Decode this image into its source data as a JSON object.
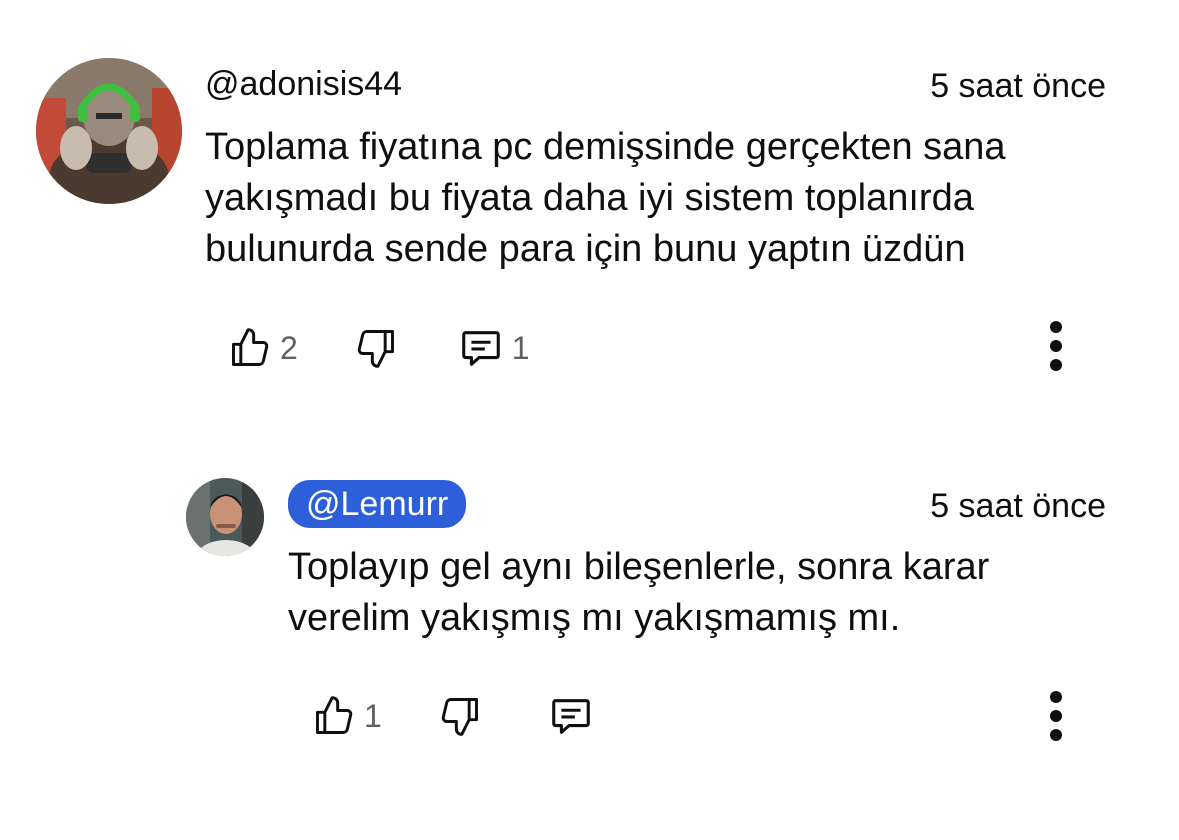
{
  "comments": [
    {
      "author": "@adonisis44",
      "time": "5 saat önce",
      "text": "Toplama fiyatına pc demişsinde gerçekten sana yakışmadı bu fiyata daha iyi sistem toplanırda bulunurda sende para için bunu yaptın üzdün",
      "likes": "2",
      "replies": "1",
      "avatar_icon": "gamer-robot-avatar"
    },
    {
      "author": "@Lemurr",
      "time": "5 saat önce",
      "text": "Toplayıp gel aynı bileşenlerle, sonra karar verelim yakışmış mı yakışmamış mı.",
      "likes": "1",
      "avatar_icon": "man-portrait-avatar"
    }
  ],
  "colors": {
    "badge_blue": "#2c5fd9",
    "text": "#0f0f0f",
    "muted": "#606060"
  },
  "icons": [
    "thumb-up-icon",
    "thumb-down-icon",
    "reply-icon",
    "more-vertical-icon"
  ]
}
